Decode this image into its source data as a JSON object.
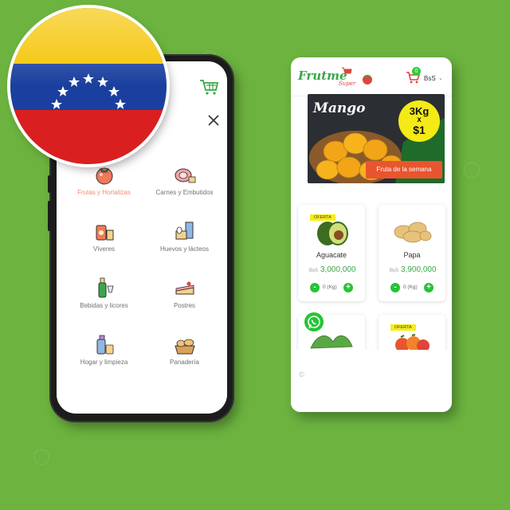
{
  "left_app": {
    "close_label": "Cerrar",
    "categories": [
      {
        "label": "Frutas y Hortalizas",
        "icon": "tomato-icon",
        "active": true
      },
      {
        "label": "Carnes y Embutidos",
        "icon": "ham-icon",
        "active": false
      },
      {
        "label": "Víveres",
        "icon": "groceries-icon",
        "active": false
      },
      {
        "label": "Huevos y lácteos",
        "icon": "dairy-icon",
        "active": false
      },
      {
        "label": "Bebidas y licores",
        "icon": "drinks-icon",
        "active": false
      },
      {
        "label": "Postres",
        "icon": "cake-icon",
        "active": false
      },
      {
        "label": "Hogar y limpieza",
        "icon": "cleaning-icon",
        "active": false
      },
      {
        "label": "Panadería",
        "icon": "bread-icon",
        "active": false
      }
    ]
  },
  "right_app": {
    "logo": "Frutme",
    "logo_sub": "Super",
    "cart_count": "0",
    "currency": "BsS",
    "banner": {
      "title": "Mango",
      "promo_line1": "3Kg",
      "promo_line2": "x",
      "promo_line3": "$1",
      "button": "Fruta de la semana"
    },
    "products": [
      {
        "name": "Aguacate",
        "currency": "BsS",
        "price": "3,000,000",
        "qty": "0 (Kg)",
        "badge": "OFERTA"
      },
      {
        "name": "Papa",
        "currency": "BsS",
        "price": "3,900,000",
        "qty": "0 (Kg)",
        "badge": ""
      },
      {
        "name": "",
        "currency": "",
        "price": "",
        "qty": "",
        "badge": ""
      },
      {
        "name": "",
        "currency": "",
        "price": "",
        "qty": "",
        "badge": "OFERTA"
      }
    ],
    "copyright_symbol": "©"
  },
  "colors": {
    "background": "#6cb33f",
    "brand_green": "#3aa64a",
    "accent_orange": "#e8552e",
    "active_category": "#f08a6c",
    "qty_button": "#25c434"
  }
}
